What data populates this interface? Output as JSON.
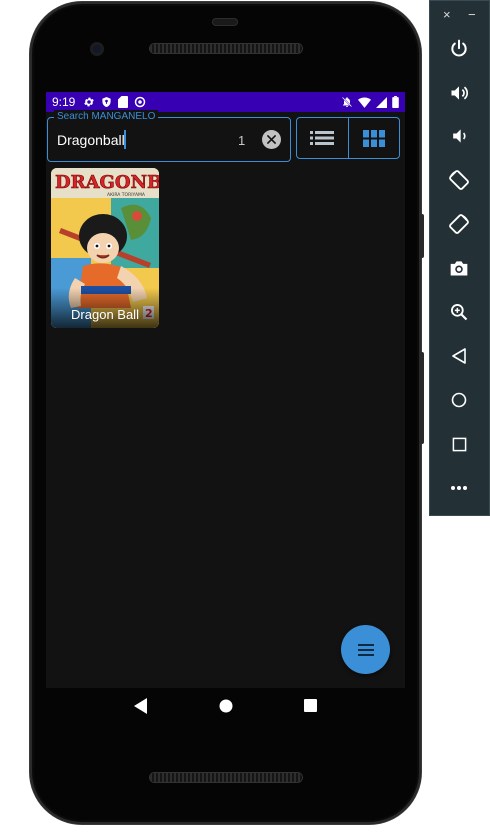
{
  "status_bar": {
    "time": "9:19"
  },
  "search": {
    "label": "Search MANGANELO",
    "value": "Dragonball",
    "count": "1"
  },
  "results": [
    {
      "title": "Dragon Ball",
      "cover_badge": "2",
      "cover_title": "DRAGONBALL",
      "cover_author": "AKIRA TORIYAMA"
    }
  ],
  "icons": {
    "status": [
      "gear-icon",
      "shield-icon",
      "sd-card-icon",
      "sync-icon",
      "notifications-off-icon",
      "wifi-icon",
      "signal-icon",
      "battery-icon"
    ],
    "view": [
      "list-view-icon",
      "grid-view-icon"
    ],
    "fab": "menu-icon",
    "nav": [
      "back-icon",
      "home-icon",
      "recents-icon"
    ],
    "emulator": [
      "power-icon",
      "volume-up-icon",
      "volume-down-icon",
      "rotate-left-icon",
      "rotate-right-icon",
      "camera-icon",
      "zoom-icon",
      "back-icon",
      "home-icon",
      "overview-icon",
      "more-icon"
    ]
  },
  "emulator": {
    "close": "×",
    "minimize": "−"
  },
  "colors": {
    "accent": "#3b8fd6",
    "status_bar": "#3700b3",
    "background": "#121212",
    "toolbar": "#233035"
  }
}
